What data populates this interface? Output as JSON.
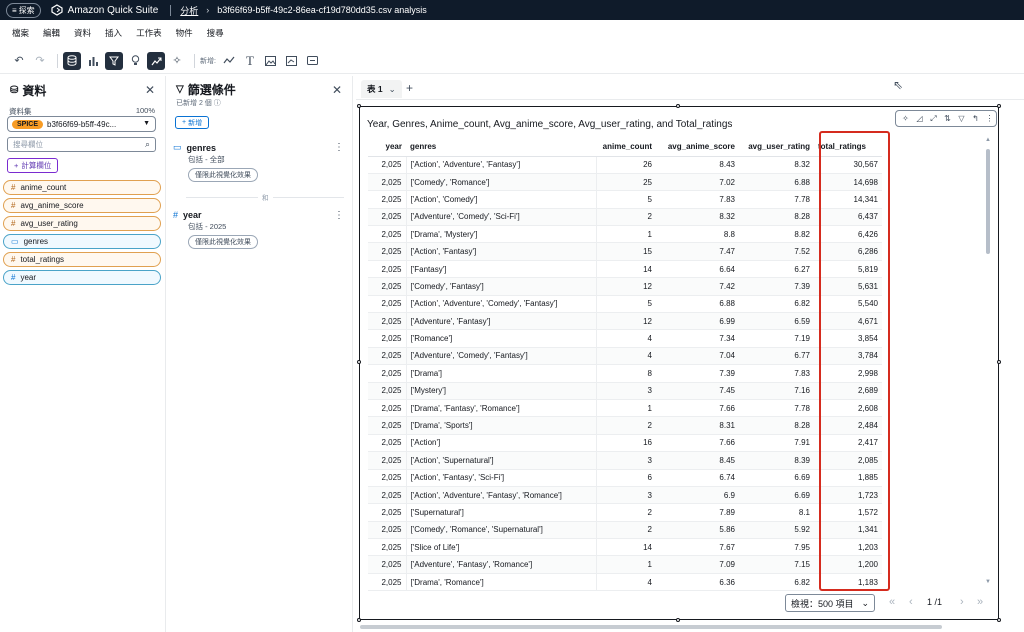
{
  "topbar": {
    "search_label": "探索",
    "app_name": "Amazon Quick Suite",
    "crumb_analysis": "分析",
    "crumb_file": "b3f66f69-b5ff-49c2-86ea-cf19d780dd35.csv analysis"
  },
  "menu": [
    "檔案",
    "編輯",
    "資料",
    "插入",
    "工作表",
    "物件",
    "搜尋"
  ],
  "toolbar": {
    "new_label": "新增:"
  },
  "data_panel": {
    "title": "資料",
    "dataset_label": "資料集",
    "dataset_pct": "100%",
    "spice": "SPICE",
    "dataset_name": "b3f66f69-b5ff-49c...",
    "search_placeholder": "搜尋欄位",
    "add_calc": "計算欄位",
    "fields": [
      {
        "name": "anime_count",
        "kind": "measure",
        "icon": "#"
      },
      {
        "name": "avg_anime_score",
        "kind": "measure",
        "icon": "#"
      },
      {
        "name": "avg_user_rating",
        "kind": "measure",
        "icon": "#"
      },
      {
        "name": "genres",
        "kind": "dim",
        "icon": "▭"
      },
      {
        "name": "total_ratings",
        "kind": "measure",
        "icon": "#"
      },
      {
        "name": "year",
        "kind": "dim",
        "icon": "#"
      }
    ]
  },
  "filter_panel": {
    "title": "篩選條件",
    "subtitle": "已新增 2 個",
    "add_label": "新增",
    "and_label": "和",
    "filters": [
      {
        "name": "genres",
        "desc": "包括 - 全部",
        "scope": "僅限此視覺化效果"
      },
      {
        "name": "year",
        "desc": "包括 - 2025",
        "scope": "僅限此視覺化效果"
      }
    ]
  },
  "sheet": {
    "tab_label": "表 1"
  },
  "visual": {
    "title": "Year, Genres, Anime_count, Avg_anime_score, Avg_user_rating, and Total_ratings",
    "columns": [
      "year",
      "genres",
      "anime_count",
      "avg_anime_score",
      "avg_user_rating",
      "total_ratings"
    ],
    "rows": [
      [
        "2,025",
        "['Action', 'Adventure', 'Fantasy']",
        "26",
        "8.43",
        "8.32",
        "30,567"
      ],
      [
        "2,025",
        "['Comedy', 'Romance']",
        "25",
        "7.02",
        "6.88",
        "14,698"
      ],
      [
        "2,025",
        "['Action', 'Comedy']",
        "5",
        "7.83",
        "7.78",
        "14,341"
      ],
      [
        "2,025",
        "['Adventure', 'Comedy', 'Sci-Fi']",
        "2",
        "8.32",
        "8.28",
        "6,437"
      ],
      [
        "2,025",
        "['Drama', 'Mystery']",
        "1",
        "8.8",
        "8.82",
        "6,426"
      ],
      [
        "2,025",
        "['Action', 'Fantasy']",
        "15",
        "7.47",
        "7.52",
        "6,286"
      ],
      [
        "2,025",
        "['Fantasy']",
        "14",
        "6.64",
        "6.27",
        "5,819"
      ],
      [
        "2,025",
        "['Comedy', 'Fantasy']",
        "12",
        "7.42",
        "7.39",
        "5,631"
      ],
      [
        "2,025",
        "['Action', 'Adventure', 'Comedy', 'Fantasy']",
        "5",
        "6.88",
        "6.82",
        "5,540"
      ],
      [
        "2,025",
        "['Adventure', 'Fantasy']",
        "12",
        "6.99",
        "6.59",
        "4,671"
      ],
      [
        "2,025",
        "['Romance']",
        "4",
        "7.34",
        "7.19",
        "3,854"
      ],
      [
        "2,025",
        "['Adventure', 'Comedy', 'Fantasy']",
        "4",
        "7.04",
        "6.77",
        "3,784"
      ],
      [
        "2,025",
        "['Drama']",
        "8",
        "7.39",
        "7.83",
        "2,998"
      ],
      [
        "2,025",
        "['Mystery']",
        "3",
        "7.45",
        "7.16",
        "2,689"
      ],
      [
        "2,025",
        "['Drama', 'Fantasy', 'Romance']",
        "1",
        "7.66",
        "7.78",
        "2,608"
      ],
      [
        "2,025",
        "['Drama', 'Sports']",
        "2",
        "8.31",
        "8.28",
        "2,484"
      ],
      [
        "2,025",
        "['Action']",
        "16",
        "7.66",
        "7.91",
        "2,417"
      ],
      [
        "2,025",
        "['Action', 'Supernatural']",
        "3",
        "8.45",
        "8.39",
        "2,085"
      ],
      [
        "2,025",
        "['Action', 'Fantasy', 'Sci-Fi']",
        "6",
        "6.74",
        "6.69",
        "1,885"
      ],
      [
        "2,025",
        "['Action', 'Adventure', 'Fantasy', 'Romance']",
        "3",
        "6.9",
        "6.69",
        "1,723"
      ],
      [
        "2,025",
        "['Supernatural']",
        "2",
        "7.89",
        "8.1",
        "1,572"
      ],
      [
        "2,025",
        "['Comedy', 'Romance', 'Supernatural']",
        "2",
        "5.86",
        "5.92",
        "1,341"
      ],
      [
        "2,025",
        "['Slice of Life']",
        "14",
        "7.67",
        "7.95",
        "1,203"
      ],
      [
        "2,025",
        "['Adventure', 'Fantasy', 'Romance']",
        "1",
        "7.09",
        "7.15",
        "1,200"
      ],
      [
        "2,025",
        "['Drama', 'Romance']",
        "4",
        "6.36",
        "6.82",
        "1,183"
      ]
    ],
    "pager_label": "檢視：500 項目",
    "page_current": "1",
    "page_total": "/1"
  }
}
